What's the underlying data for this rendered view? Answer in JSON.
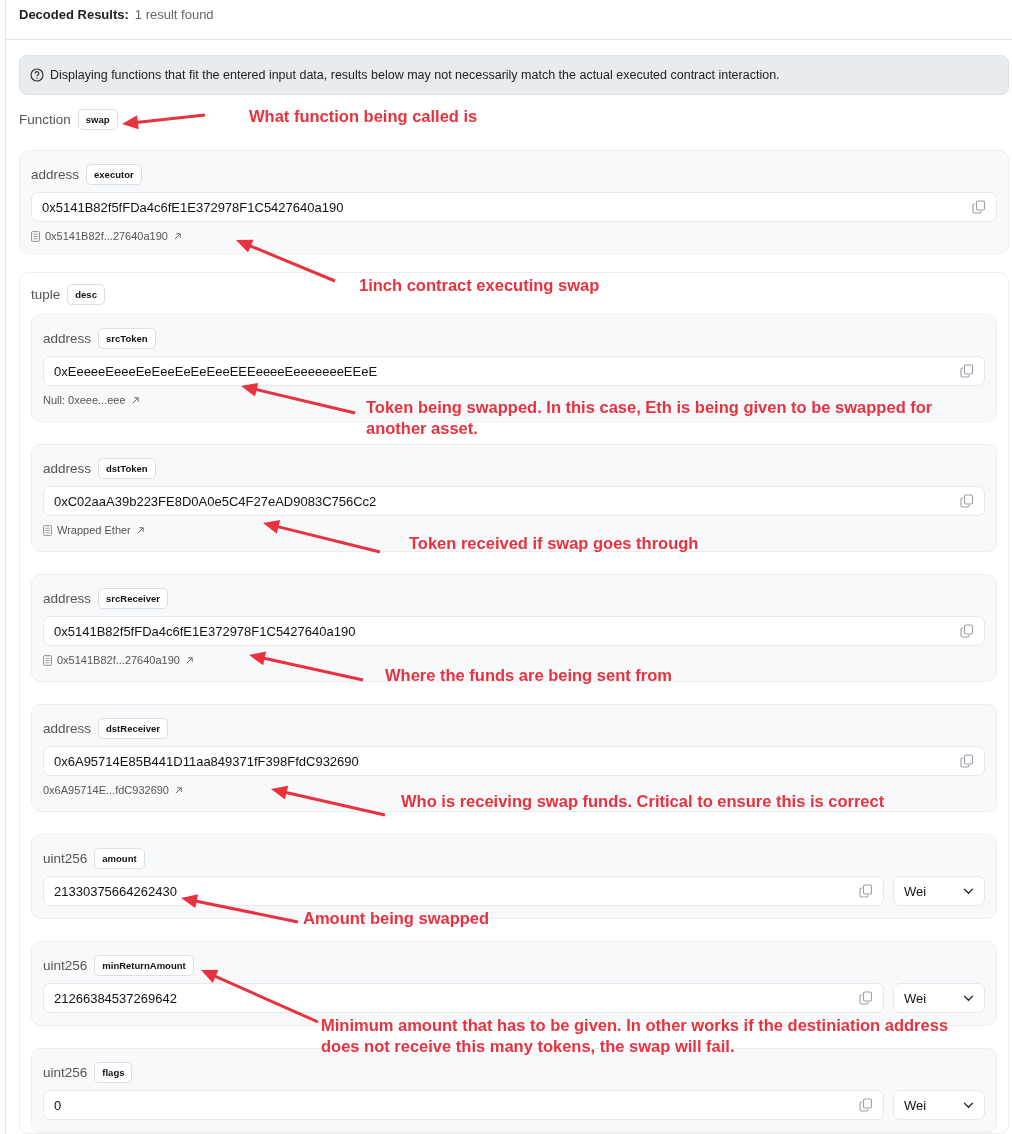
{
  "header": {
    "title": "Decoded Results:",
    "count": "1 result found"
  },
  "notice": "Displaying functions that fit the entered input data, results below may not necessarily match the actual executed contract interaction.",
  "function": {
    "label": "Function",
    "name": "swap"
  },
  "params": [
    {
      "kind": "address",
      "type": "address",
      "name": "executor",
      "value": "0x5141B82f5fFDa4c6fE1E372978F1C5427640a190",
      "link": {
        "text": "0x5141B82f...27640a190",
        "document": true
      }
    }
  ],
  "tuple": {
    "type": "tuple",
    "name": "desc",
    "components": [
      {
        "kind": "address",
        "type": "address",
        "name": "srcToken",
        "value": "0xEeeeeEeeeEeEeeEeEeEeeEEEeeeeEeeeeeeeEEeE",
        "link": {
          "text": "Null: 0xeee...eee",
          "document": false
        }
      },
      {
        "kind": "address",
        "type": "address",
        "name": "dstToken",
        "value": "0xC02aaA39b223FE8D0A0e5C4F27eAD9083C756Cc2",
        "link": {
          "text": "Wrapped Ether",
          "document": true
        }
      },
      {
        "kind": "address",
        "type": "address",
        "name": "srcReceiver",
        "value": "0x5141B82f5fFDa4c6fE1E372978F1C5427640a190",
        "link": {
          "text": "0x5141B82f...27640a190",
          "document": true
        }
      },
      {
        "kind": "address",
        "type": "address",
        "name": "dstReceiver",
        "value": "0x6A95714E85B441D11aa849371fF398FfdC932690",
        "link": {
          "text": "0x6A95714E...fdC932690",
          "document": false
        }
      },
      {
        "kind": "uint",
        "type": "uint256",
        "name": "amount",
        "value": "21330375664262430",
        "unit": "Wei"
      },
      {
        "kind": "uint",
        "type": "uint256",
        "name": "minReturnAmount",
        "value": "21266384537269642",
        "unit": "Wei"
      },
      {
        "kind": "uint",
        "type": "uint256",
        "name": "flags",
        "value": "0",
        "unit": "Wei"
      }
    ]
  },
  "annotations": [
    {
      "text": "What function being called is"
    },
    {
      "text": "1inch contract executing swap"
    },
    {
      "text": "Token being swapped. In this case, Eth is being given to be swapped for another asset."
    },
    {
      "text": "Token received if swap goes through"
    },
    {
      "text": "Where the funds are being sent from"
    },
    {
      "text": "Who is receiving swap funds. Critical to ensure this is correct"
    },
    {
      "text": "Amount being swapped"
    },
    {
      "text": "Minimum amount that has to be given. In other works if the destiniation address does not receive this many tokens, the swap will fail."
    }
  ]
}
